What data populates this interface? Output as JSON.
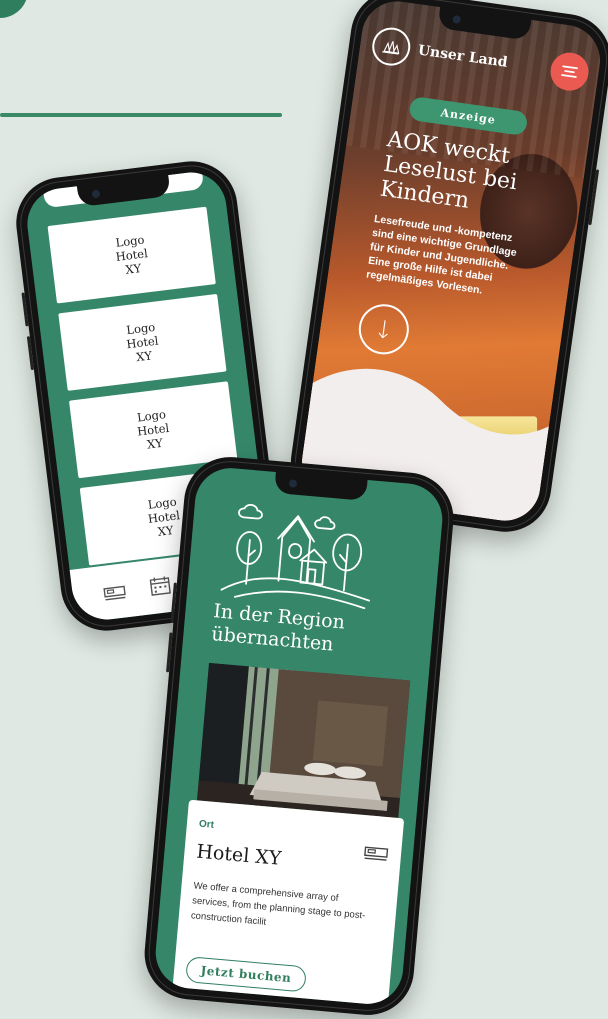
{
  "left_phone": {
    "hotel_logos": [
      {
        "label": "Logo\nHotel\nXY"
      },
      {
        "label": "Logo\nHotel\nXY"
      },
      {
        "label": "Logo\nHotel\nXY"
      },
      {
        "label": "Logo\nHotel\nXY"
      }
    ],
    "bottom_nav_icons": [
      "bed-icon",
      "calendar-icon"
    ]
  },
  "right_phone": {
    "brand_name": "Unser Land",
    "badge": "Anzeige",
    "title": "AOK weckt\nLeselust bei\nKindern",
    "lead": "Lesefreude und -kompetenz\nsind eine wichtige Grundlage\nfür Kinder und Jugendliche.\nEine große Hilfe ist dabei\nregelmäßiges Vorlesen.",
    "menu_icon": "menu-icon",
    "scroll_icon": "arrow-down-icon",
    "accent_color": "#ea5a50"
  },
  "front_phone": {
    "heading": "In der Region\nübernachten",
    "card": {
      "label": "Ort",
      "title": "Hotel XY",
      "description": "We offer a comprehensive array of services, from the planning stage to post-construction facilit",
      "button": "Jetzt buchen",
      "icon": "bed-icon"
    }
  },
  "colors": {
    "brand_green": "#36876a",
    "background": "#dfe8e3"
  }
}
